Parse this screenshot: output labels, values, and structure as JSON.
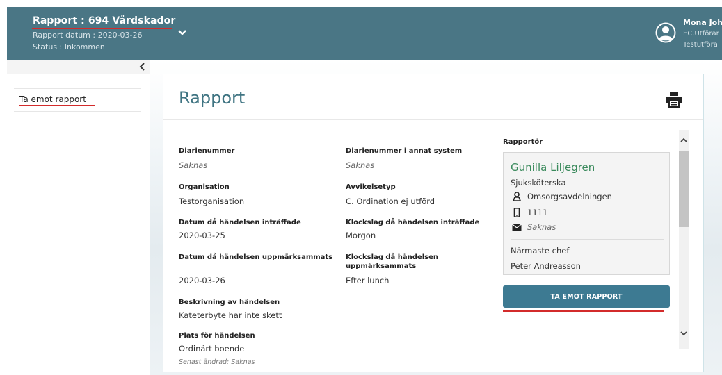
{
  "header": {
    "title": "Rapport : 694 Vårdskador",
    "report_date": "Rapport datum : 2020-03-26",
    "status": "Status : Inkommen",
    "user_name": "Mona Joh",
    "user_role1": "EC.Utförar",
    "user_role2": "Testutföra"
  },
  "sidebar": {
    "items": [
      {
        "label": "Ta emot rapport"
      }
    ]
  },
  "card": {
    "title": "Rapport",
    "footnote": "Senast ändrad: Saknas"
  },
  "fields": {
    "diarienummer": {
      "label": "Diarienummer",
      "value": "Saknas"
    },
    "diarienummer_annat": {
      "label": "Diarienummer i annat system",
      "value": "Saknas"
    },
    "organisation": {
      "label": "Organisation",
      "value": "Testorganisation"
    },
    "avvikelsetyp": {
      "label": "Avvikelsetyp",
      "value": "C. Ordination ej utförd"
    },
    "datum_intraffade": {
      "label": "Datum då händelsen inträffade",
      "value": "2020-03-25"
    },
    "klockslag_intraffade": {
      "label": "Klockslag då händelsen inträffade",
      "value": "Morgon"
    },
    "datum_uppmarksammats": {
      "label": "Datum då händelsen uppmärksammats",
      "value": "2020-03-26"
    },
    "klockslag_uppmarksammats": {
      "label_line1": "Klockslag då händelsen",
      "label_line2": "uppmärksammats",
      "value": "Efter lunch"
    },
    "beskrivning": {
      "label": "Beskrivning av händelsen",
      "value": "Kateterbyte har inte skett"
    },
    "plats": {
      "label": "Plats för händelsen",
      "value": "Ordinärt boende"
    }
  },
  "reporter": {
    "heading": "Rapportör",
    "name": "Gunilla Liljegren",
    "title": "Sjuksköterska",
    "department": "Omsorgsavdelningen",
    "phone": "1111",
    "email": "Saknas",
    "manager_label": "Närmaste chef",
    "manager_name": "Peter Andreasson"
  },
  "actions": {
    "receive_button": "TA EMOT RAPPORT"
  },
  "colors": {
    "header_bg": "#4a7685",
    "accent_title": "#3f7482",
    "reporter_name": "#3a8a5c",
    "button_bg": "#3d7a92",
    "underline": "#d32b2b"
  }
}
